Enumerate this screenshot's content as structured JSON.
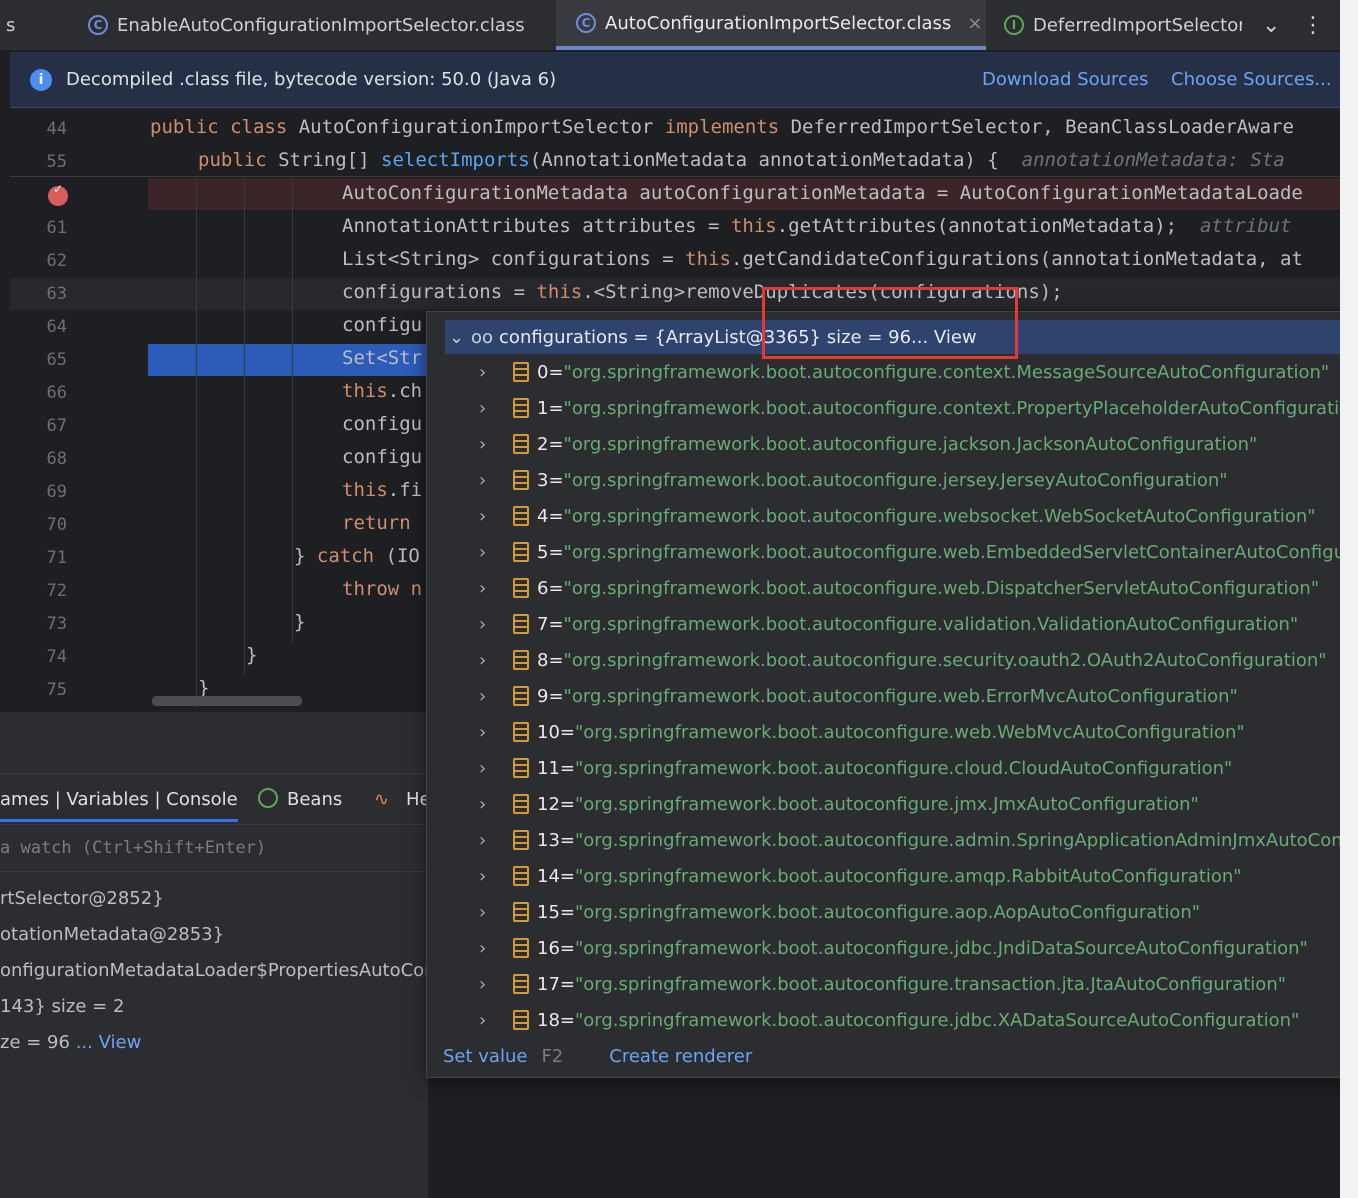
{
  "tabs": [
    {
      "label": "s",
      "icon": "class-icon",
      "active": false
    },
    {
      "label": "EnableAutoConfigurationImportSelector.class",
      "icon": "class-icon",
      "active": false
    },
    {
      "label": "AutoConfigurationImportSelector.class",
      "icon": "class-icon",
      "active": true,
      "close": "×"
    },
    {
      "label": "DeferredImportSelector.",
      "icon": "interface-icon",
      "active": false
    }
  ],
  "tab_icons": {
    "class": "C",
    "interface": "I",
    "more": "⋮",
    "dropdown": "⌄"
  },
  "banner": {
    "message": "Decompiled .class file, bytecode version: 50.0 (Java 6)",
    "download": "Download Sources",
    "choose": "Choose Sources..."
  },
  "editor": {
    "lines": [
      {
        "num": "44",
        "tokens": [
          [
            "kw",
            "public class "
          ],
          [
            "",
            "AutoConfigurationImportSelector "
          ],
          [
            "kw",
            "implements "
          ],
          [
            "",
            "DeferredImportSelector, BeanClassLoaderAware"
          ]
        ],
        "indent": 0
      },
      {
        "num": "55",
        "tokens": [
          [
            "kw",
            "public "
          ],
          [
            "",
            "String[] "
          ],
          [
            "fn",
            "selectImports"
          ],
          [
            "",
            "(AnnotationMetadata annotationMetadata) {  "
          ],
          [
            "hint",
            "annotationMetadata: Sta"
          ]
        ],
        "indent": 1
      },
      {
        "num": "",
        "tokens": [
          [
            "",
            "AutoConfigurationMetadata autoConfigurationMetadata = AutoConfigurationMetadataLoade"
          ]
        ],
        "indent": 4
      },
      {
        "num": "61",
        "tokens": [
          [
            "",
            "AnnotationAttributes attributes = "
          ],
          [
            "kw",
            "this"
          ],
          [
            "",
            ".getAttributes(annotationMetadata);  "
          ],
          [
            "hint",
            "attribut"
          ]
        ],
        "indent": 4
      },
      {
        "num": "62",
        "tokens": [
          [
            "",
            "List<String> configurations = "
          ],
          [
            "kw",
            "this"
          ],
          [
            "",
            ".getCandidateConfigurations(annotationMetadata, at"
          ]
        ],
        "indent": 4
      },
      {
        "num": "63",
        "tokens": [
          [
            "",
            "configurations = "
          ],
          [
            "kw",
            "this"
          ],
          [
            "",
            ".<String>removeDuplicates(configurations);"
          ]
        ],
        "indent": 4
      },
      {
        "num": "64",
        "tokens": [
          [
            "",
            "configu"
          ]
        ],
        "indent": 4
      },
      {
        "num": "65",
        "tokens": [
          [
            "",
            "Set<Str"
          ]
        ],
        "indent": 4
      },
      {
        "num": "66",
        "tokens": [
          [
            "kw",
            "this"
          ],
          [
            "",
            ".ch"
          ]
        ],
        "indent": 4
      },
      {
        "num": "67",
        "tokens": [
          [
            "",
            "configu"
          ]
        ],
        "indent": 4
      },
      {
        "num": "68",
        "tokens": [
          [
            "",
            "configu"
          ]
        ],
        "indent": 4
      },
      {
        "num": "69",
        "tokens": [
          [
            "kw",
            "this"
          ],
          [
            "",
            ".fi"
          ]
        ],
        "indent": 4
      },
      {
        "num": "70",
        "tokens": [
          [
            "kw",
            "return "
          ]
        ],
        "indent": 4
      },
      {
        "num": "71",
        "tokens": [
          [
            "",
            "} "
          ],
          [
            "kw",
            "catch "
          ],
          [
            "",
            "(IO"
          ]
        ],
        "indent": 3
      },
      {
        "num": "72",
        "tokens": [
          [
            "kw",
            "throw "
          ],
          [
            "kw",
            "n"
          ]
        ],
        "indent": 4
      },
      {
        "num": "73",
        "tokens": [
          [
            "",
            "}"
          ]
        ],
        "indent": 3
      },
      {
        "num": "74",
        "tokens": [
          [
            "",
            "}"
          ]
        ],
        "indent": 2
      },
      {
        "num": "75",
        "tokens": [
          [
            "",
            "}"
          ]
        ],
        "indent": 1
      }
    ]
  },
  "debug": {
    "tabs_label": "ames | Variables | Console",
    "beans": "Beans",
    "he": "He",
    "watch_placeholder": "a watch (Ctrl+Shift+Enter)",
    "vars": [
      {
        "text": "rtSelector@2852}"
      },
      {
        "text": "otationMetadata@2853}"
      },
      {
        "text": "onfigurationMetadataLoader$PropertiesAutoConf"
      },
      {
        "text": "143}  size = 2"
      },
      {
        "text": "ze = 96 ",
        "link": "... View"
      }
    ]
  },
  "popup": {
    "header_prefix": "configurations = {ArrayList@3365}  size = 96 ",
    "header_link": "... View",
    "items": [
      {
        "index": "0",
        "value": "\"org.springframework.boot.autoconfigure.context.MessageSourceAutoConfiguration\""
      },
      {
        "index": "1",
        "value": "\"org.springframework.boot.autoconfigure.context.PropertyPlaceholderAutoConfiguration\""
      },
      {
        "index": "2",
        "value": "\"org.springframework.boot.autoconfigure.jackson.JacksonAutoConfiguration\""
      },
      {
        "index": "3",
        "value": "\"org.springframework.boot.autoconfigure.jersey.JerseyAutoConfiguration\""
      },
      {
        "index": "4",
        "value": "\"org.springframework.boot.autoconfigure.websocket.WebSocketAutoConfiguration\""
      },
      {
        "index": "5",
        "value": "\"org.springframework.boot.autoconfigure.web.EmbeddedServletContainerAutoConfiguratio"
      },
      {
        "index": "6",
        "value": "\"org.springframework.boot.autoconfigure.web.DispatcherServletAutoConfiguration\""
      },
      {
        "index": "7",
        "value": "\"org.springframework.boot.autoconfigure.validation.ValidationAutoConfiguration\""
      },
      {
        "index": "8",
        "value": "\"org.springframework.boot.autoconfigure.security.oauth2.OAuth2AutoConfiguration\""
      },
      {
        "index": "9",
        "value": "\"org.springframework.boot.autoconfigure.web.ErrorMvcAutoConfiguration\""
      },
      {
        "index": "10",
        "value": "\"org.springframework.boot.autoconfigure.web.WebMvcAutoConfiguration\""
      },
      {
        "index": "11",
        "value": "\"org.springframework.boot.autoconfigure.cloud.CloudAutoConfiguration\""
      },
      {
        "index": "12",
        "value": "\"org.springframework.boot.autoconfigure.jmx.JmxAutoConfiguration\""
      },
      {
        "index": "13",
        "value": "\"org.springframework.boot.autoconfigure.admin.SpringApplicationAdminJmxAutoConfigu"
      },
      {
        "index": "14",
        "value": "\"org.springframework.boot.autoconfigure.amqp.RabbitAutoConfiguration\""
      },
      {
        "index": "15",
        "value": "\"org.springframework.boot.autoconfigure.aop.AopAutoConfiguration\""
      },
      {
        "index": "16",
        "value": "\"org.springframework.boot.autoconfigure.jdbc.JndiDataSourceAutoConfiguration\""
      },
      {
        "index": "17",
        "value": "\"org.springframework.boot.autoconfigure.transaction.jta.JtaAutoConfiguration\""
      },
      {
        "index": "18",
        "value": "\"org.springframework.boot.autoconfigure.jdbc.XADataSourceAutoConfiguration\""
      }
    ],
    "footer": {
      "set_value": "Set value",
      "shortcut": "F2",
      "create_renderer": "Create renderer"
    }
  },
  "colors": {
    "accent": "#6ea4f5",
    "string": "#6aab73",
    "keyword": "#cf8e6d",
    "highlight": "#e53935"
  }
}
